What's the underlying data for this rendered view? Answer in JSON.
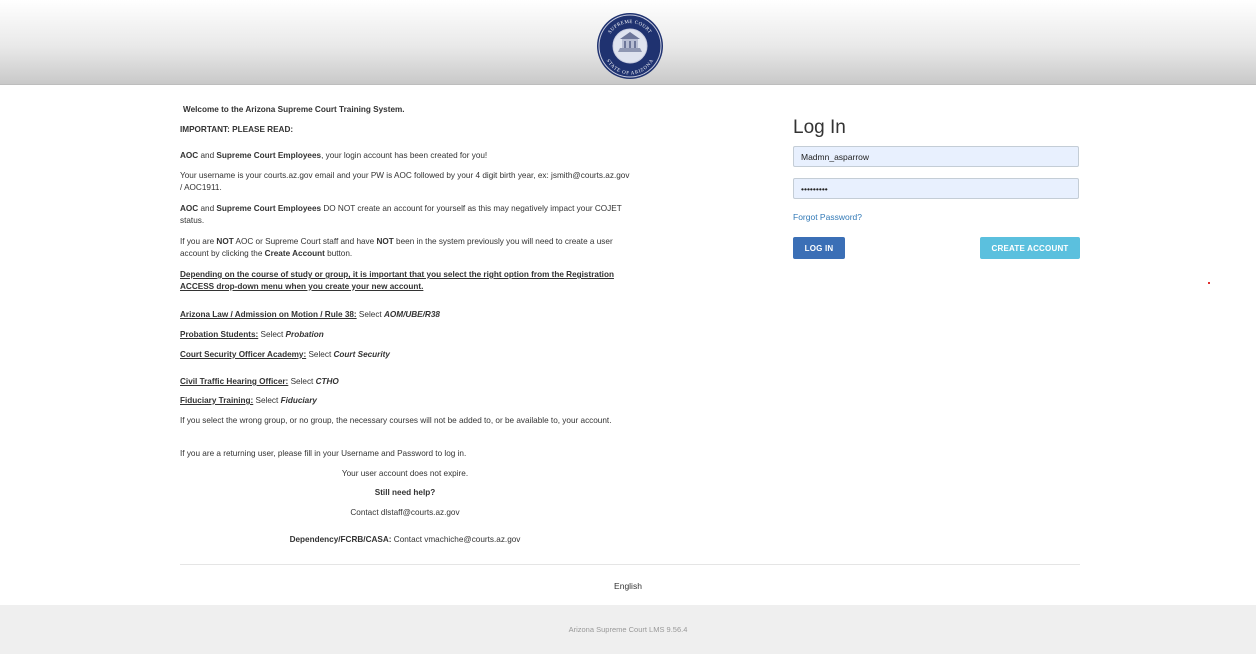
{
  "intro": {
    "welcome": "Welcome to the Arizona Supreme Court Training System.",
    "important": "IMPORTANT: PLEASE READ:",
    "p1_aoc": "AOC",
    "p1_and": " and ",
    "p1_sce": "Supreme Court Employees",
    "p1_rest": ", your login account has been created for you!",
    "p2": "Your username is your courts.az.gov email and your PW is AOC followed by your 4 digit birth year, ex: jsmith@courts.az.gov / AOC1911.",
    "p3_aoc": "AOC",
    "p3_and": " and ",
    "p3_sce": "Supreme Court Employees",
    "p3_rest": " DO NOT create an account for yourself as this may negatively impact your COJET status.",
    "p4_a": "If you are ",
    "p4_not1": "NOT",
    "p4_b": " AOC or Supreme Court staff and have ",
    "p4_not2": "NOT",
    "p4_c": " been in the system previously you will need to create a user account by clicking the ",
    "p4_ca": "Create Account",
    "p4_d": " button.",
    "p5": "Depending on the course of study or group, it is important that you select the right option from the Registration ACCESS drop-down menu when you create your new account.",
    "options": [
      {
        "label": "Arizona Law / Admission on Motion / Rule 38:",
        "select": " Select ",
        "value": "AOM/UBE/R38"
      },
      {
        "label": "Probation Students:",
        "select": " Select ",
        "value": "Probation"
      },
      {
        "label": "Court Security Officer Academy:",
        "select": " Select ",
        "value": "Court Security"
      },
      {
        "label": "Civil Traffic Hearing Officer:",
        "select": " Select ",
        "value": "CTHO"
      },
      {
        "label": "Fiduciary Training:",
        "select": " Select ",
        "value": "Fiduciary"
      }
    ],
    "p6": "If you select the wrong group, or no group, the necessary courses will not be added to, or be available to, your account.",
    "p7": "If you are a returning user, please fill in your Username and Password to log in.",
    "p8": "Your user account does not expire.",
    "help": "Still need help?",
    "contact": "Contact dlstaff@courts.az.gov",
    "dep_label": "Dependency/FCRB/CASA:",
    "dep_rest": " Contact vmachiche@courts.az.gov"
  },
  "login": {
    "title": "Log In",
    "username": "Madmn_asparrow",
    "password": "password1",
    "forgot": "Forgot Password?",
    "login_btn": "LOG IN",
    "create_btn": "CREATE ACCOUNT"
  },
  "seal": {
    "top_text": "SUPREME COURT",
    "bottom_text": "STATE OF ARIZONA"
  },
  "language": "English",
  "footer": "Arizona Supreme Court LMS 9.56.4"
}
